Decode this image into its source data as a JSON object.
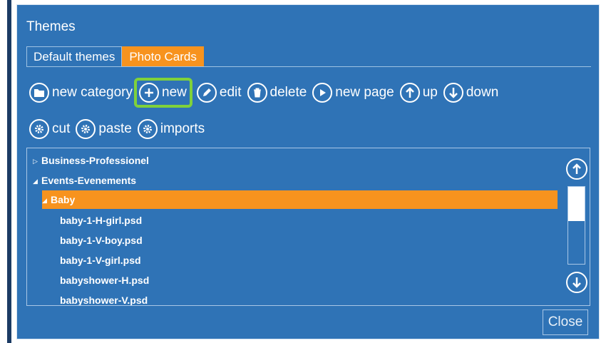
{
  "window": {
    "title": "Themes"
  },
  "tabs": [
    {
      "label": "Default themes",
      "active": false
    },
    {
      "label": "Photo Cards",
      "active": true
    }
  ],
  "toolbar": {
    "new_category": "new category",
    "new": "new",
    "edit": "edit",
    "delete": "delete",
    "new_page": "new page",
    "up": "up",
    "down": "down",
    "cut": "cut",
    "paste": "paste",
    "imports": "imports"
  },
  "tree": {
    "items": [
      {
        "label": "Business-Professionel",
        "expanded": false
      },
      {
        "label": "Events-Evenements",
        "expanded": true
      },
      {
        "label": "Baby",
        "expanded": true,
        "selected": true
      },
      {
        "label": "baby-1-H-girl.psd"
      },
      {
        "label": "baby-1-V-boy.psd"
      },
      {
        "label": "baby-1-V-girl.psd"
      },
      {
        "label": "babyshower-H.psd"
      },
      {
        "label": "babyshower-V.psd"
      }
    ],
    "scroll_position": 0.0
  },
  "close_label": "Close",
  "colors": {
    "background": "#2f73b6",
    "accent": "#f7931e",
    "highlight": "#7fd13b",
    "text": "#ffffff"
  },
  "icons": {
    "new_category": "folder-icon",
    "new": "plus-icon",
    "edit": "pencil-icon",
    "delete": "trash-icon",
    "new_page": "play-icon",
    "up": "arrow-up-icon",
    "down": "arrow-down-icon",
    "cut": "gear-icon",
    "paste": "gear-icon",
    "imports": "gear-icon"
  }
}
